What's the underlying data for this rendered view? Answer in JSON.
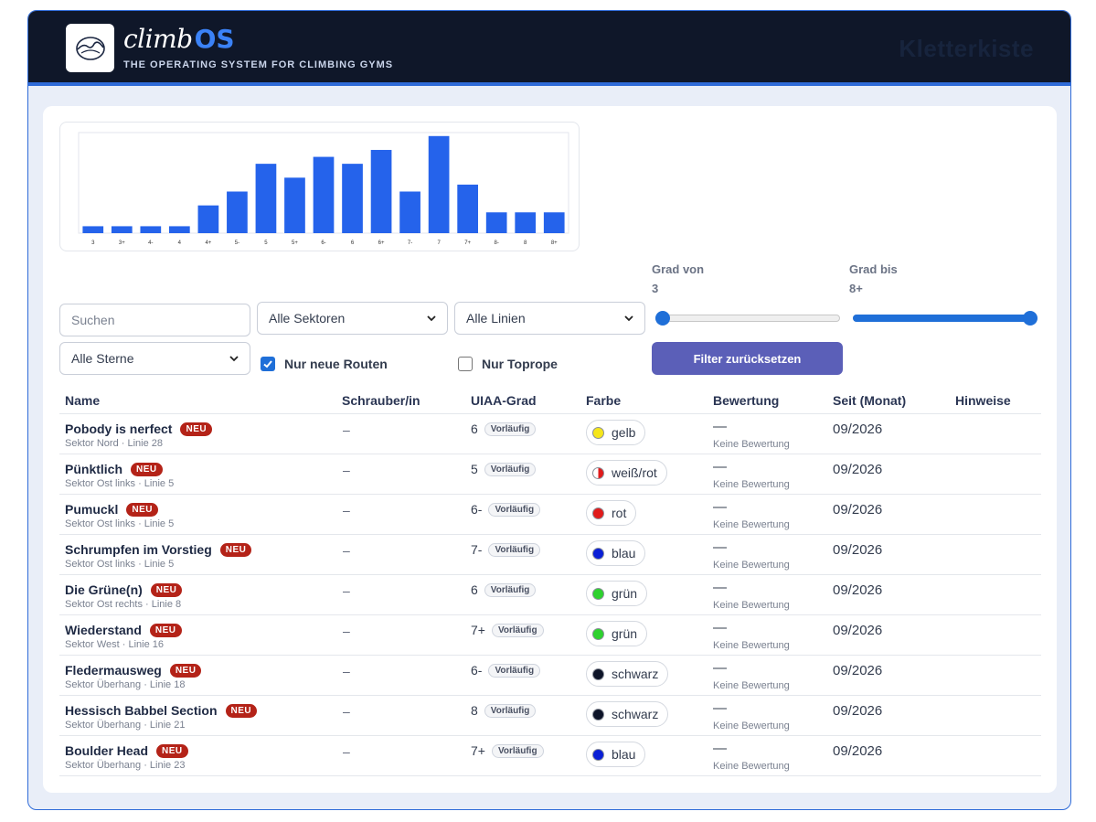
{
  "header": {
    "brand_climb": "climb",
    "brand_os": "OS",
    "tagline": "THE OPERATING SYSTEM FOR CLIMBING GYMS",
    "gym_name": "Kletterkiste"
  },
  "chart_data": {
    "type": "bar",
    "categories": [
      "3",
      "3+",
      "4-",
      "4",
      "4+",
      "5-",
      "5",
      "5+",
      "6-",
      "6",
      "6+",
      "7-",
      "7",
      "7+",
      "8-",
      "8",
      "8+"
    ],
    "values": [
      1,
      1,
      1,
      1,
      4,
      6,
      10,
      8,
      11,
      10,
      12,
      6,
      14,
      7,
      3,
      3,
      3
    ],
    "ylim": [
      0,
      14.5
    ],
    "title": "",
    "xlabel": "",
    "ylabel": "",
    "color": "#2563eb",
    "grid": false
  },
  "filters": {
    "search_placeholder": "Suchen",
    "sector_select": "Alle Sektoren",
    "line_select": "Alle Linien",
    "stars_select": "Alle Sterne",
    "grade_from_label": "Grad von",
    "grade_from_value": "3",
    "grade_to_label": "Grad bis",
    "grade_to_value": "8+",
    "grade_from_fraction": 0.0,
    "grade_to_fraction": 1.0,
    "only_new_label": "Nur neue Routen",
    "only_new_checked": true,
    "only_toprope_label": "Nur Toprope",
    "only_toprope_checked": false,
    "reset_button": "Filter zurücksetzen"
  },
  "table": {
    "columns": [
      "Name",
      "Schrauber/in",
      "UIAA-Grad",
      "Farbe",
      "Bewertung",
      "Seit (Monat)",
      "Hinweise"
    ],
    "rows": [
      {
        "name": "Pobody is nerfect",
        "badge": "NEU",
        "sub": "Sektor Nord · Linie 28",
        "setter": "–",
        "grade": "6",
        "grade_tag": "Vorläufig",
        "color": "gelb",
        "color_hex": "#f5e61b",
        "rating": "—",
        "rating_note": "Keine Bewertung",
        "since": "09/2026"
      },
      {
        "name": "Pünktlich",
        "badge": "NEU",
        "sub": "Sektor Ost links · Linie 5",
        "setter": "–",
        "grade": "5",
        "grade_tag": "Vorläufig",
        "color": "weiß/rot",
        "color_hex": "split",
        "rating": "—",
        "rating_note": "Keine Bewertung",
        "since": "09/2026"
      },
      {
        "name": "Pumuckl",
        "badge": "NEU",
        "sub": "Sektor Ost links · Linie 5",
        "setter": "–",
        "grade": "6-",
        "grade_tag": "Vorläufig",
        "color": "rot",
        "color_hex": "#e01b1b",
        "rating": "—",
        "rating_note": "Keine Bewertung",
        "since": "09/2026"
      },
      {
        "name": "Schrumpfen im Vorstieg",
        "badge": "NEU",
        "sub": "Sektor Ost links · Linie 5",
        "setter": "–",
        "grade": "7-",
        "grade_tag": "Vorläufig",
        "color": "blau",
        "color_hex": "#0a1fd6",
        "rating": "—",
        "rating_note": "Keine Bewertung",
        "since": "09/2026"
      },
      {
        "name": "Die Grüne(n)",
        "badge": "NEU",
        "sub": "Sektor Ost rechts · Linie 8",
        "setter": "–",
        "grade": "6",
        "grade_tag": "Vorläufig",
        "color": "grün",
        "color_hex": "#2ed12e",
        "rating": "—",
        "rating_note": "Keine Bewertung",
        "since": "09/2026"
      },
      {
        "name": "Wiederstand",
        "badge": "NEU",
        "sub": "Sektor West · Linie 16",
        "setter": "–",
        "grade": "7+",
        "grade_tag": "Vorläufig",
        "color": "grün",
        "color_hex": "#2ed12e",
        "rating": "—",
        "rating_note": "Keine Bewertung",
        "since": "09/2026"
      },
      {
        "name": "Fledermausweg",
        "badge": "NEU",
        "sub": "Sektor Überhang · Linie 18",
        "setter": "–",
        "grade": "6-",
        "grade_tag": "Vorläufig",
        "color": "schwarz",
        "color_hex": "#0d1428",
        "rating": "—",
        "rating_note": "Keine Bewertung",
        "since": "09/2026"
      },
      {
        "name": "Hessisch Babbel Section",
        "badge": "NEU",
        "sub": "Sektor Überhang · Linie 21",
        "setter": "–",
        "grade": "8",
        "grade_tag": "Vorläufig",
        "color": "schwarz",
        "color_hex": "#0d1428",
        "rating": "—",
        "rating_note": "Keine Bewertung",
        "since": "09/2026"
      },
      {
        "name": "Boulder Head",
        "badge": "NEU",
        "sub": "Sektor Überhang · Linie 23",
        "setter": "–",
        "grade": "7+",
        "grade_tag": "Vorläufig",
        "color": "blau",
        "color_hex": "#0a1fd6",
        "rating": "—",
        "rating_note": "Keine Bewertung",
        "since": "09/2026"
      }
    ]
  }
}
